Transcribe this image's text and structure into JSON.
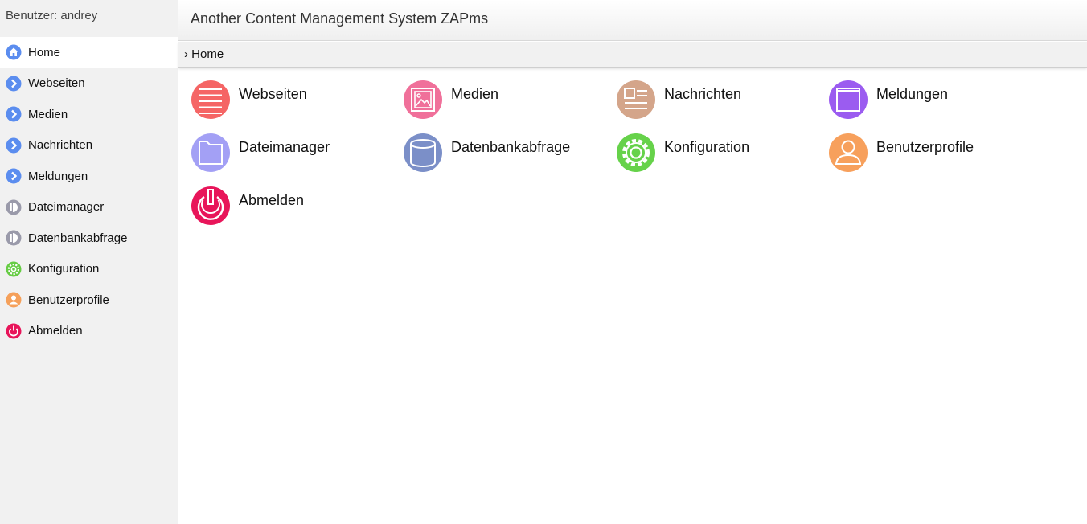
{
  "sidebar": {
    "user_label": "Benutzer: andrey",
    "items": [
      {
        "label": "Home",
        "icon": "home-icon",
        "color": "#5b8def",
        "active": true
      },
      {
        "label": "Webseiten",
        "icon": "chevron-right-icon",
        "color": "#5b8def"
      },
      {
        "label": "Medien",
        "icon": "chevron-right-icon",
        "color": "#5b8def"
      },
      {
        "label": "Nachrichten",
        "icon": "chevron-right-icon",
        "color": "#5b8def"
      },
      {
        "label": "Meldungen",
        "icon": "chevron-right-icon",
        "color": "#5b8def"
      },
      {
        "label": "Dateimanager",
        "icon": "half-circle-icon",
        "color": "#9a9aaa"
      },
      {
        "label": "Datenbankabfrage",
        "icon": "half-circle-icon",
        "color": "#9a9aaa"
      },
      {
        "label": "Konfiguration",
        "icon": "gear-icon",
        "color": "#66cc44"
      },
      {
        "label": "Benutzerprofile",
        "icon": "user-icon",
        "color": "#f5a05a"
      },
      {
        "label": "Abmelden",
        "icon": "power-icon",
        "color": "#e8155a"
      }
    ]
  },
  "header": {
    "title": "Another Content Management System ZAPms"
  },
  "breadcrumb": {
    "text": "› Home"
  },
  "tiles": [
    {
      "label": "Webseiten",
      "icon": "list-icon",
      "color": "#f56565"
    },
    {
      "label": "Medien",
      "icon": "image-icon",
      "color": "#f0709a"
    },
    {
      "label": "Nachrichten",
      "icon": "news-icon",
      "color": "#d4a58a"
    },
    {
      "label": "Meldungen",
      "icon": "window-icon",
      "color": "#9b5cf0"
    },
    {
      "label": "Dateimanager",
      "icon": "folder-icon",
      "color": "#a3a0f5"
    },
    {
      "label": "Datenbankabfrage",
      "icon": "database-icon",
      "color": "#7b8fc8"
    },
    {
      "label": "Konfiguration",
      "icon": "gear-icon",
      "color": "#66d24a"
    },
    {
      "label": "Benutzerprofile",
      "icon": "user-icon",
      "color": "#f7a05c"
    },
    {
      "label": "Abmelden",
      "icon": "power-icon",
      "color": "#e8155a"
    }
  ]
}
